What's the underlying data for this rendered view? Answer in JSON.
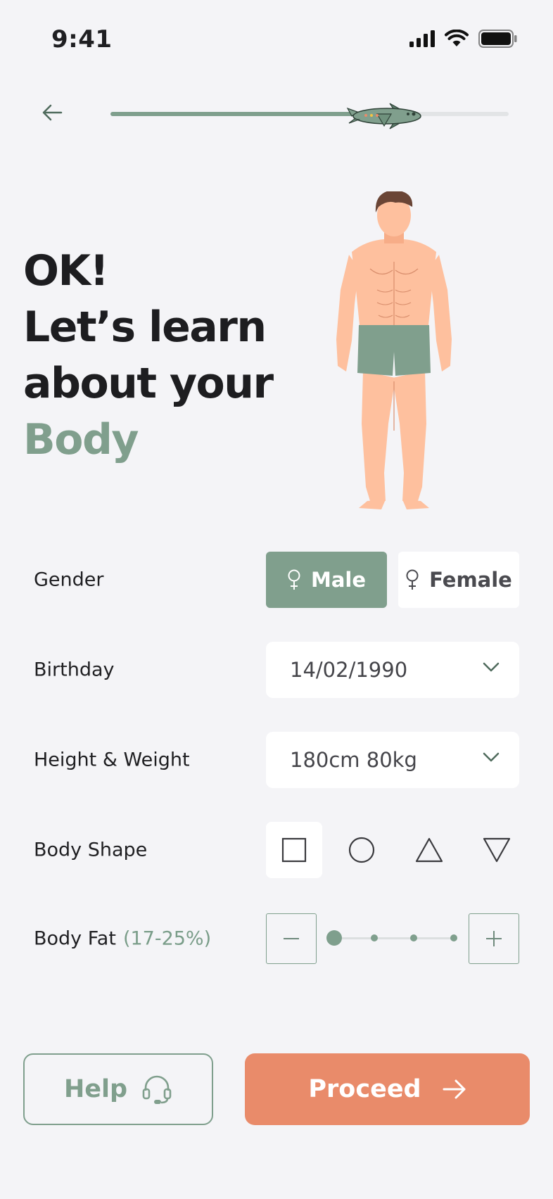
{
  "status_bar": {
    "time": "9:41"
  },
  "progress": {
    "value": 0.69
  },
  "headline": {
    "line1": "OK!",
    "line2": "Let’s learn",
    "line3": "about your",
    "accent": "Body"
  },
  "form": {
    "gender": {
      "label": "Gender",
      "options": [
        "Male",
        "Female"
      ],
      "selected": "Male"
    },
    "birthday": {
      "label": "Birthday",
      "value": "14/02/1990"
    },
    "height_weight": {
      "label": "Height & Weight",
      "value": "180cm 80kg"
    },
    "body_shape": {
      "label": "Body Shape",
      "options": [
        "square-icon",
        "circle-icon",
        "triangle-icon",
        "inverted-triangle-icon"
      ],
      "selected": 0
    },
    "body_fat": {
      "label": "Body Fat",
      "range": "(17-25%)",
      "steps": 4,
      "selected_step": 0
    }
  },
  "buttons": {
    "help": "Help",
    "proceed": "Proceed"
  },
  "colors": {
    "accent_green": "#809f8d",
    "proceed_orange": "#e98b6a",
    "background": "#f4f4f7"
  }
}
